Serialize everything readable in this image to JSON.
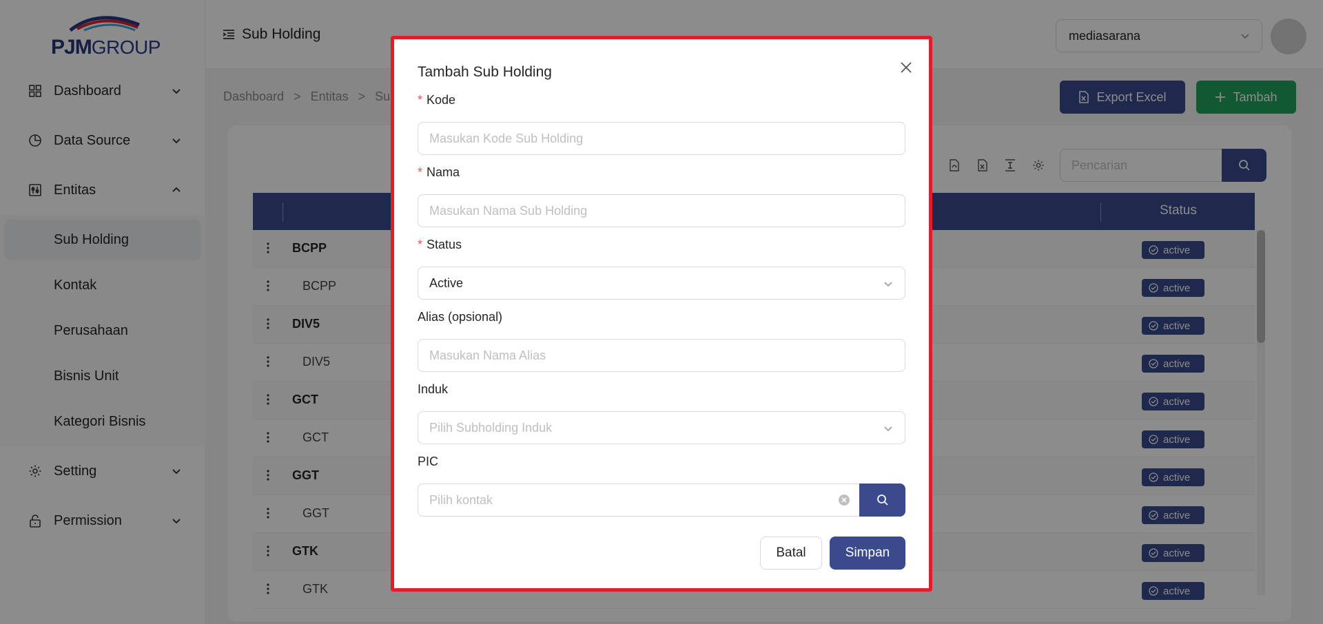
{
  "brand": {
    "logo_text": "PJM",
    "logo_text_2": "GROUP"
  },
  "sidebar": {
    "items": [
      {
        "label": "Dashboard",
        "icon": "dashboard-icon"
      },
      {
        "label": "Data Source",
        "icon": "pie-chart-icon"
      },
      {
        "label": "Entitas",
        "icon": "control-icon"
      },
      {
        "label": "Setting",
        "icon": "gear-icon"
      },
      {
        "label": "Permission",
        "icon": "lock-icon"
      }
    ],
    "sub_items": [
      "Sub Holding",
      "Kontak",
      "Perusahaan",
      "Bisnis Unit",
      "Kategori Bisnis"
    ]
  },
  "header": {
    "title": "Sub Holding",
    "org_select": "mediasarana"
  },
  "breadcrumb": [
    "Dashboard",
    ">",
    "Entitas",
    ">",
    "Su"
  ],
  "actions": {
    "export_label": "Export Excel",
    "add_label": "Tambah"
  },
  "search": {
    "placeholder": "Pencarian"
  },
  "table": {
    "status_header": "Status",
    "rows": [
      {
        "code": "BCPP",
        "type": "parent",
        "status": "active"
      },
      {
        "code": "BCPP",
        "type": "child",
        "status": "active"
      },
      {
        "code": "DIV5",
        "type": "parent",
        "status": "active"
      },
      {
        "code": "DIV5",
        "type": "child",
        "status": "active"
      },
      {
        "code": "GCT",
        "type": "parent",
        "status": "active"
      },
      {
        "code": "GCT",
        "type": "child",
        "status": "active"
      },
      {
        "code": "GGT",
        "type": "parent",
        "status": "active"
      },
      {
        "code": "GGT",
        "type": "child",
        "status": "active"
      },
      {
        "code": "GTK",
        "type": "parent",
        "status": "active"
      },
      {
        "code": "GTK",
        "type": "child",
        "status": "active"
      }
    ]
  },
  "modal": {
    "title": "Tambah Sub Holding",
    "fields": {
      "kode": {
        "label": "Kode",
        "placeholder": "Masukan Kode Sub Holding"
      },
      "nama": {
        "label": "Nama",
        "placeholder": "Masukan Nama Sub Holding"
      },
      "status": {
        "label": "Status",
        "value": "Active"
      },
      "alias": {
        "label": "Alias (opsional)",
        "placeholder": "Masukan Nama Alias"
      },
      "induk": {
        "label": "Induk",
        "placeholder": "Pilih Subholding Induk"
      },
      "pic": {
        "label": "PIC",
        "placeholder": "Pilih kontak"
      }
    },
    "required_mark": "*",
    "cancel_label": "Batal",
    "save_label": "Simpan"
  },
  "colors": {
    "primary": "#3a4a8c",
    "success": "#22a05b",
    "highlight_border": "#e11d2a",
    "required": "#ff4d4f"
  }
}
